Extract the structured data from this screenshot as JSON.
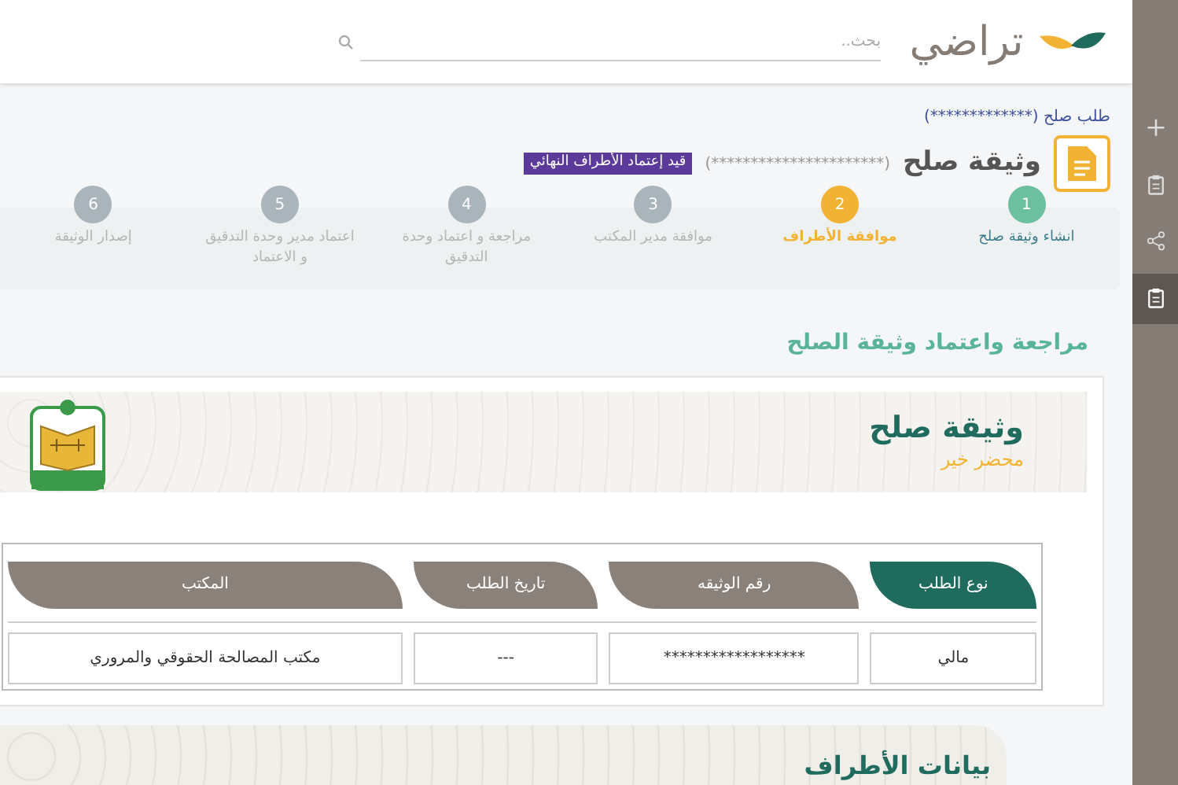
{
  "header": {
    "logo_text": "تراضي",
    "search": {
      "placeholder": "بحث.."
    }
  },
  "sidebar": {
    "items": [
      {
        "kind": "plus",
        "selected": false
      },
      {
        "kind": "clipboard",
        "selected": false
      },
      {
        "kind": "share",
        "selected": false
      },
      {
        "kind": "clipboard",
        "selected": true
      }
    ]
  },
  "breadcrumb": "طلب صلح (*************)",
  "title": {
    "text": "وثيقة صلح",
    "number": "(**********************)",
    "badge": "قيد إعتماد الأطراف النهائي"
  },
  "steps": [
    {
      "number": "1",
      "label": "انشاء وثيقة صلح",
      "completed": true,
      "selected": false
    },
    {
      "number": "2",
      "label": "موافقة الأطراف",
      "completed": false,
      "selected": true
    },
    {
      "number": "3",
      "label": "موافقة مدير المكتب",
      "completed": false,
      "selected": false
    },
    {
      "number": "4",
      "label": "مراجعة و اعتماد وحدة التدقيق",
      "completed": false,
      "selected": false
    },
    {
      "number": "5",
      "label": "اعتماد مدير وحدة التدقيق و الاعتماد",
      "completed": false,
      "selected": false
    },
    {
      "number": "6",
      "label": "إصدار الوثيقة",
      "completed": false,
      "selected": false
    }
  ],
  "section_title": "مراجعة واعتماد وثيقة الصلح",
  "document": {
    "title": "وثيقة صلح",
    "subtitle": "محضر خير",
    "table": {
      "columns": [
        {
          "label": "نوع الطلب",
          "selected": true
        },
        {
          "label": "رقم الوثيقه",
          "selected": false
        },
        {
          "label": "تاريخ الطلب",
          "selected": false
        },
        {
          "label": "المكتب",
          "selected": false
        }
      ],
      "rows": [
        [
          "مالي",
          "******************",
          "---",
          "مكتب المصالحة الحقوقي والمروري"
        ]
      ]
    }
  },
  "parties_title": "بيانات الأطراف"
}
